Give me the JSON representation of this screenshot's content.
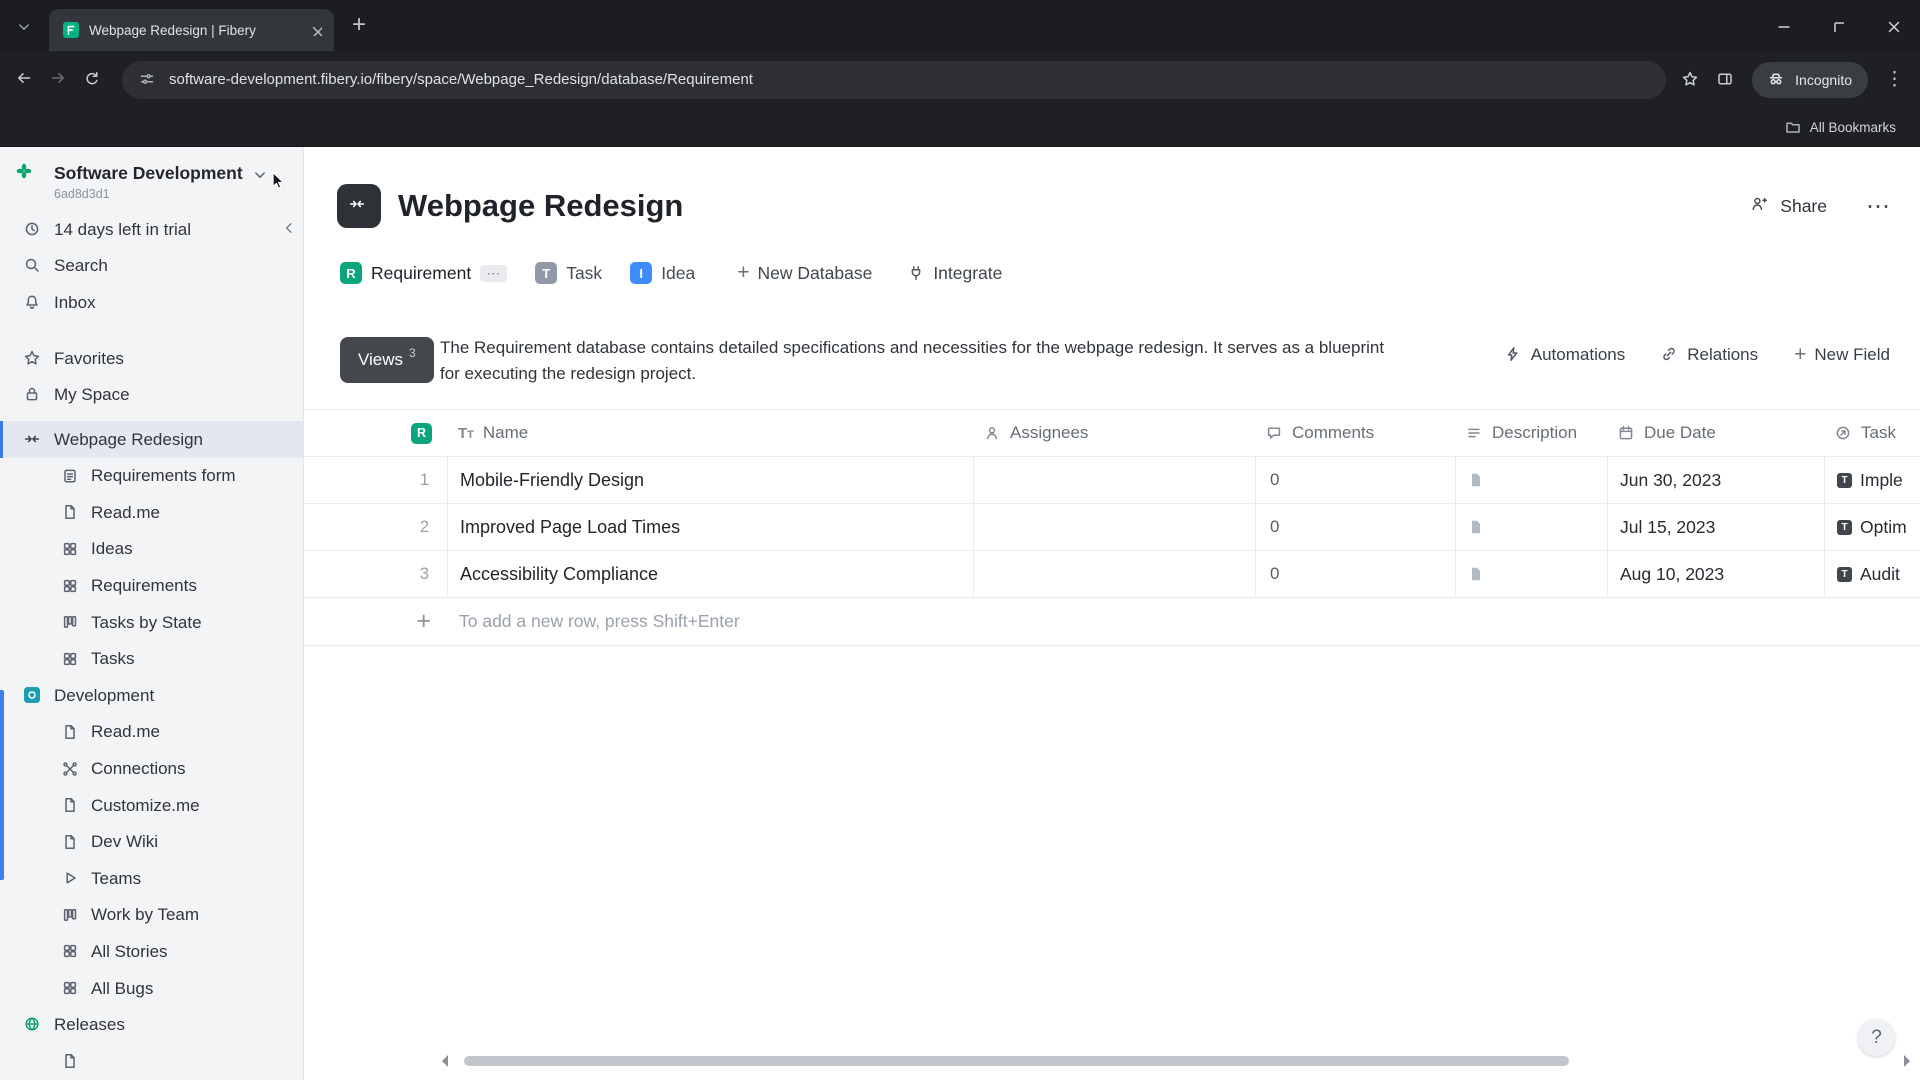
{
  "colors": {
    "requirement_green": "#0aa57c",
    "task_gray": "#8f99a8",
    "idea_blue": "#3f8cff",
    "selection_blue": "#3b7ce0",
    "views_button_bg": "#44474c"
  },
  "browser": {
    "tab_title": "Webpage Redesign | Fibery",
    "url": "software-development.fibery.io/fibery/space/Webpage_Redesign/database/Requirement",
    "incognito_label": "Incognito",
    "bookmarks_label": "All Bookmarks"
  },
  "sidebar": {
    "workspace_name": "Software Development",
    "workspace_id": "6ad8d3d1",
    "items": [
      {
        "label": "14 days left in trial",
        "icon": "clock-icon"
      },
      {
        "label": "Search",
        "icon": "search-icon"
      },
      {
        "label": "Inbox",
        "icon": "bell-icon"
      },
      {
        "label": "Favorites",
        "icon": "star-icon"
      },
      {
        "label": "My Space",
        "icon": "lock-icon"
      },
      {
        "label": "Webpage Redesign",
        "icon": "space-arrows-icon"
      },
      {
        "label": "Requirements form",
        "icon": "form-icon"
      },
      {
        "label": "Read.me",
        "icon": "document-icon"
      },
      {
        "label": "Ideas",
        "icon": "grid-icon"
      },
      {
        "label": "Requirements",
        "icon": "grid-icon"
      },
      {
        "label": "Tasks by State",
        "icon": "board-icon"
      },
      {
        "label": "Tasks",
        "icon": "grid-icon"
      },
      {
        "label": "Development",
        "icon": "dev-space-icon"
      },
      {
        "label": "Read.me",
        "icon": "document-icon"
      },
      {
        "label": "Connections",
        "icon": "connections-icon"
      },
      {
        "label": "Customize.me",
        "icon": "document-icon"
      },
      {
        "label": "Dev Wiki",
        "icon": "document-icon"
      },
      {
        "label": "Teams",
        "icon": "play-icon"
      },
      {
        "label": "Work by Team",
        "icon": "board-icon"
      },
      {
        "label": "All Stories",
        "icon": "grid-icon"
      },
      {
        "label": "All Bugs",
        "icon": "grid-icon"
      },
      {
        "label": "Releases",
        "icon": "globe-icon"
      }
    ]
  },
  "main": {
    "title": "Webpage Redesign",
    "share_label": "Share",
    "databases": [
      {
        "badge": "R",
        "label": "Requirement"
      },
      {
        "badge": "T",
        "label": "Task"
      },
      {
        "badge": "I",
        "label": "Idea"
      }
    ],
    "new_database_label": "New Database",
    "integrate_label": "Integrate",
    "views_label": "Views",
    "views_count": "3",
    "description_line1": "The Requirement database contains detailed specifications and necessities for the webpage redesign. It serves as a blueprint",
    "description_line2": "for executing the redesign project.",
    "automations_label": "Automations",
    "relations_label": "Relations",
    "new_field_label": "New Field",
    "table": {
      "header_badge": "R",
      "columns": [
        "Name",
        "Assignees",
        "Comments",
        "Description",
        "Due Date",
        "Task"
      ],
      "rows": [
        {
          "num": "1",
          "name": "Mobile-Friendly Design",
          "comments": "0",
          "due_date": "Jun 30, 2023",
          "task": "Imple"
        },
        {
          "num": "2",
          "name": "Improved Page Load Times",
          "comments": "0",
          "due_date": "Jul 15, 2023",
          "task": "Optim"
        },
        {
          "num": "3",
          "name": "Accessibility Compliance",
          "comments": "0",
          "due_date": "Aug 10, 2023",
          "task": "Audit"
        }
      ],
      "add_row_hint": "To add a new row, press Shift+Enter"
    },
    "help_label": "?"
  }
}
